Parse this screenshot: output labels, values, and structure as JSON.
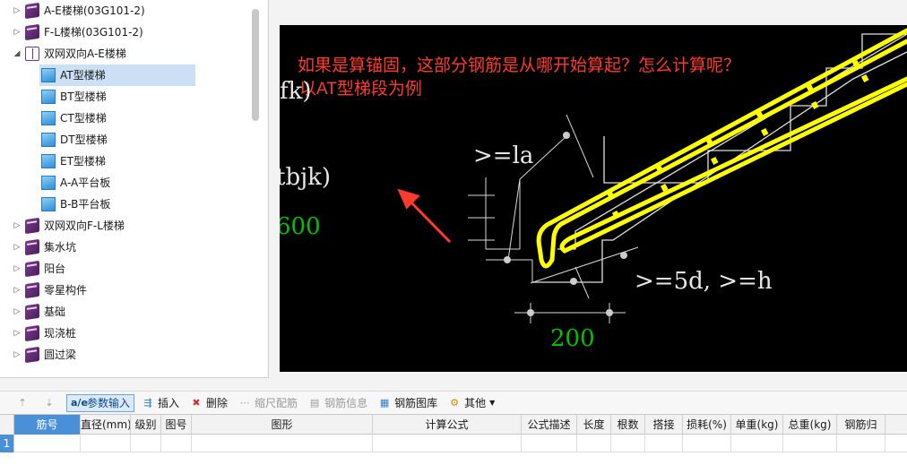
{
  "tree": {
    "items": [
      {
        "label": "A-E楼梯(03G101-2)",
        "expanded": false,
        "icon": "book-icon"
      },
      {
        "label": "F-L楼梯(03G101-2)",
        "expanded": false,
        "icon": "book-icon"
      },
      {
        "label": "双网双向A-E楼梯",
        "expanded": true,
        "icon": "open-book-icon"
      },
      {
        "label": "AT型楼梯",
        "selected": true,
        "icon": "file-icon"
      },
      {
        "label": "BT型楼梯",
        "icon": "file-icon"
      },
      {
        "label": "CT型楼梯",
        "icon": "file-icon"
      },
      {
        "label": "DT型楼梯",
        "icon": "file-icon"
      },
      {
        "label": "ET型楼梯",
        "icon": "file-icon"
      },
      {
        "label": "A-A平台板",
        "icon": "file-icon"
      },
      {
        "label": "B-B平台板",
        "icon": "file-icon"
      },
      {
        "label": "双网双向F-L楼梯",
        "expanded": false,
        "icon": "book-icon"
      },
      {
        "label": "集水坑",
        "expanded": false,
        "icon": "book-icon"
      },
      {
        "label": "阳台",
        "expanded": false,
        "icon": "book-icon"
      },
      {
        "label": "零星构件",
        "expanded": false,
        "icon": "book-icon"
      },
      {
        "label": "基础",
        "expanded": false,
        "icon": "book-icon"
      },
      {
        "label": "现浇桩",
        "expanded": false,
        "icon": "book-icon"
      },
      {
        "label": "圆过梁",
        "expanded": false,
        "icon": "book-icon"
      }
    ]
  },
  "canvas": {
    "question_line1": "如果是算锚固，这部分钢筋是从哪开始算起？怎么计算呢？",
    "question_line2": "以AT型梯段为例",
    "label_fk": "fk)",
    "label_tbjk": "tbjk)",
    "label_600": "600",
    "label_la": ">=la",
    "label_5d": ">=5d, >=h",
    "label_200": "200",
    "colors": {
      "background": "#000000",
      "rebar": "#ffff00",
      "annotation": "#ff3b30",
      "dimension_text": "#00c000",
      "lines": "#ffffff"
    }
  },
  "toolbar": {
    "up_icon": "move-up-icon",
    "down_icon": "move-down-icon",
    "param_input": "参数输入",
    "insert": "插入",
    "delete": "删除",
    "scale_rebar": "缩尺配筋",
    "rebar_info": "钢筋信息",
    "rebar_library": "钢筋图库",
    "other": "其他"
  },
  "table": {
    "columns": [
      "筋号",
      "直径(mm)",
      "级别",
      "图号",
      "图形",
      "计算公式",
      "公式描述",
      "长度",
      "根数",
      "搭接",
      "损耗(%)",
      "单重(kg)",
      "总重(kg)",
      "钢筋归"
    ],
    "row_numbers": [
      "1"
    ]
  }
}
